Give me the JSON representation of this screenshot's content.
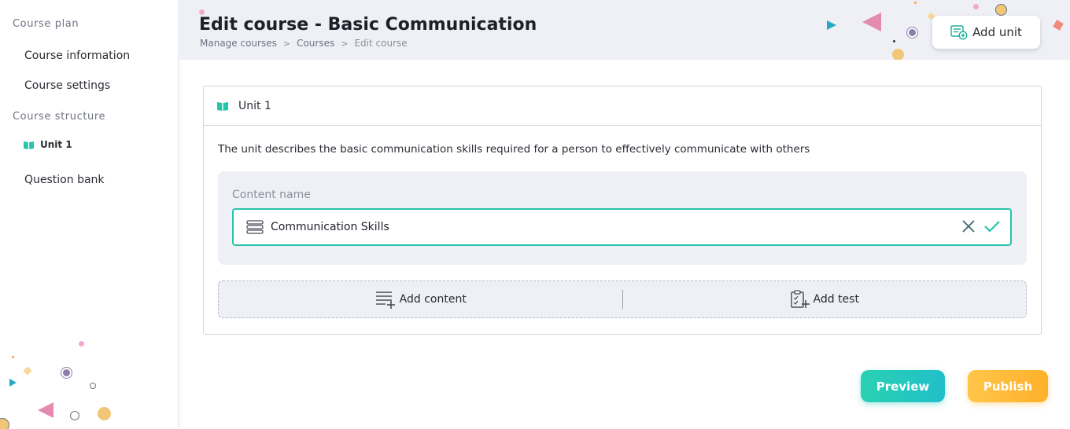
{
  "sidebar": {
    "section_plan": "Course plan",
    "course_information": "Course information",
    "course_settings": "Course settings",
    "section_structure": "Course structure",
    "unit_item": "Unit 1",
    "question_bank": "Question bank"
  },
  "header": {
    "title": "Edit course - Basic Communication",
    "breadcrumb": [
      "Manage courses",
      "Courses",
      "Edit course"
    ],
    "add_unit_label": "Add unit"
  },
  "unit": {
    "title": "Unit 1",
    "description": "The unit describes the basic communication skills required for a person to effectively communicate with others",
    "content_label": "Content name",
    "content_value": "Communication Skills",
    "add_content_label": "Add content",
    "add_test_label": "Add test"
  },
  "footer": {
    "preview_label": "Preview",
    "publish_label": "Publish"
  },
  "colors": {
    "accent": "#27c4ac",
    "preview": "#22c7bd",
    "publish": "#ffb838",
    "header_bg": "#eef0f6"
  },
  "icons": [
    "book-open-icon",
    "add-list-icon",
    "close-icon",
    "check-icon",
    "list-icon",
    "add-content-icon",
    "add-test-icon"
  ]
}
